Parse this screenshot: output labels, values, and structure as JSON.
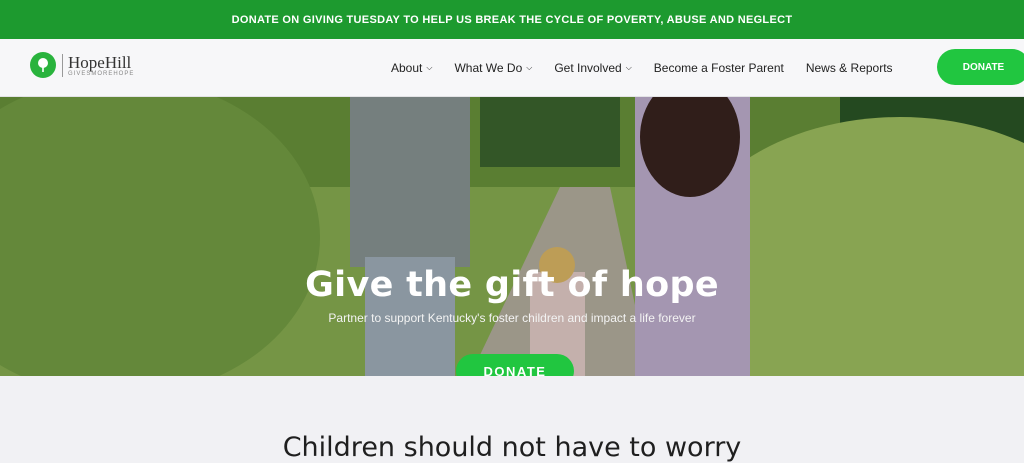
{
  "announcement": {
    "text": "DONATE ON GIVING TUESDAY TO HELP US BREAK THE CYCLE OF POVERTY, ABUSE AND NEGLECT"
  },
  "brand": {
    "name": "HopeHill",
    "tagline": "GIVESMOREHOPE",
    "color": "#29b33d"
  },
  "nav": {
    "items": [
      {
        "label": "About",
        "icon": "chevron-down-icon"
      },
      {
        "label": "What We Do",
        "icon": "chevron-down-icon"
      },
      {
        "label": "Get Involved",
        "icon": "chevron-down-icon"
      },
      {
        "label": "Become a Foster Parent"
      },
      {
        "label": "News & Reports"
      }
    ],
    "donate_label": "DONATE"
  },
  "hero": {
    "title": "Give the gift of hope",
    "subtitle": "Partner to support Kentucky's foster children and impact a life forever",
    "button_label": "DONATE"
  },
  "section": {
    "heading": "Children should not have to worry"
  },
  "colors": {
    "accent": "#21c640",
    "topbar": "#1d9a2f"
  }
}
